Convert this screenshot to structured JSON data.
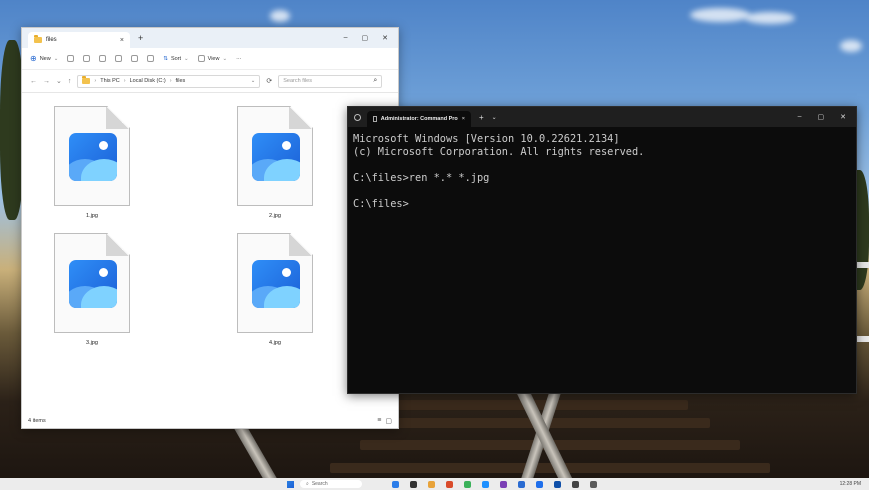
{
  "explorer": {
    "tab_title": "files",
    "tab_close": "×",
    "new_tab": "+",
    "window_controls": {
      "minimize": "–",
      "maximize": "▢",
      "close": "✕"
    },
    "toolbar": {
      "new_label": "New",
      "sort_label": "Sort",
      "view_label": "View",
      "more_label": "···"
    },
    "address": {
      "back": "←",
      "forward": "→",
      "recent": "⌄",
      "up": "↑",
      "crumbs": [
        "This PC",
        "Local Disk (C:)",
        "files"
      ],
      "search_placeholder": "Search files"
    },
    "files": [
      {
        "label": "1.jpg"
      },
      {
        "label": "2.jpg"
      },
      {
        "label": "3.jpg"
      },
      {
        "label": "4.jpg"
      }
    ],
    "status_text": "4 items"
  },
  "cmd": {
    "tab_title": "Administrator: Command Pro",
    "tab_close": "×",
    "new_tab": "+",
    "dropdown": "⌄",
    "window_controls": {
      "minimize": "–",
      "maximize": "▢",
      "close": "✕"
    },
    "lines": [
      "Microsoft Windows [Version 10.0.22621.2134]",
      "(c) Microsoft Corporation. All rights reserved.",
      "",
      "C:\\files>ren *.* *.jpg",
      "",
      "C:\\files>"
    ]
  },
  "taskbar": {
    "search_label": "Search",
    "clock": "12:28 PM",
    "app_colors": [
      "#2b7de9",
      "#333333",
      "#e8a33a",
      "#d94b2b",
      "#3bb15a",
      "#1e90ff",
      "#7b3fb5",
      "#2a6bd1",
      "#1f6feb",
      "#0f4fa8",
      "#444444",
      "#5a5a5a"
    ]
  }
}
